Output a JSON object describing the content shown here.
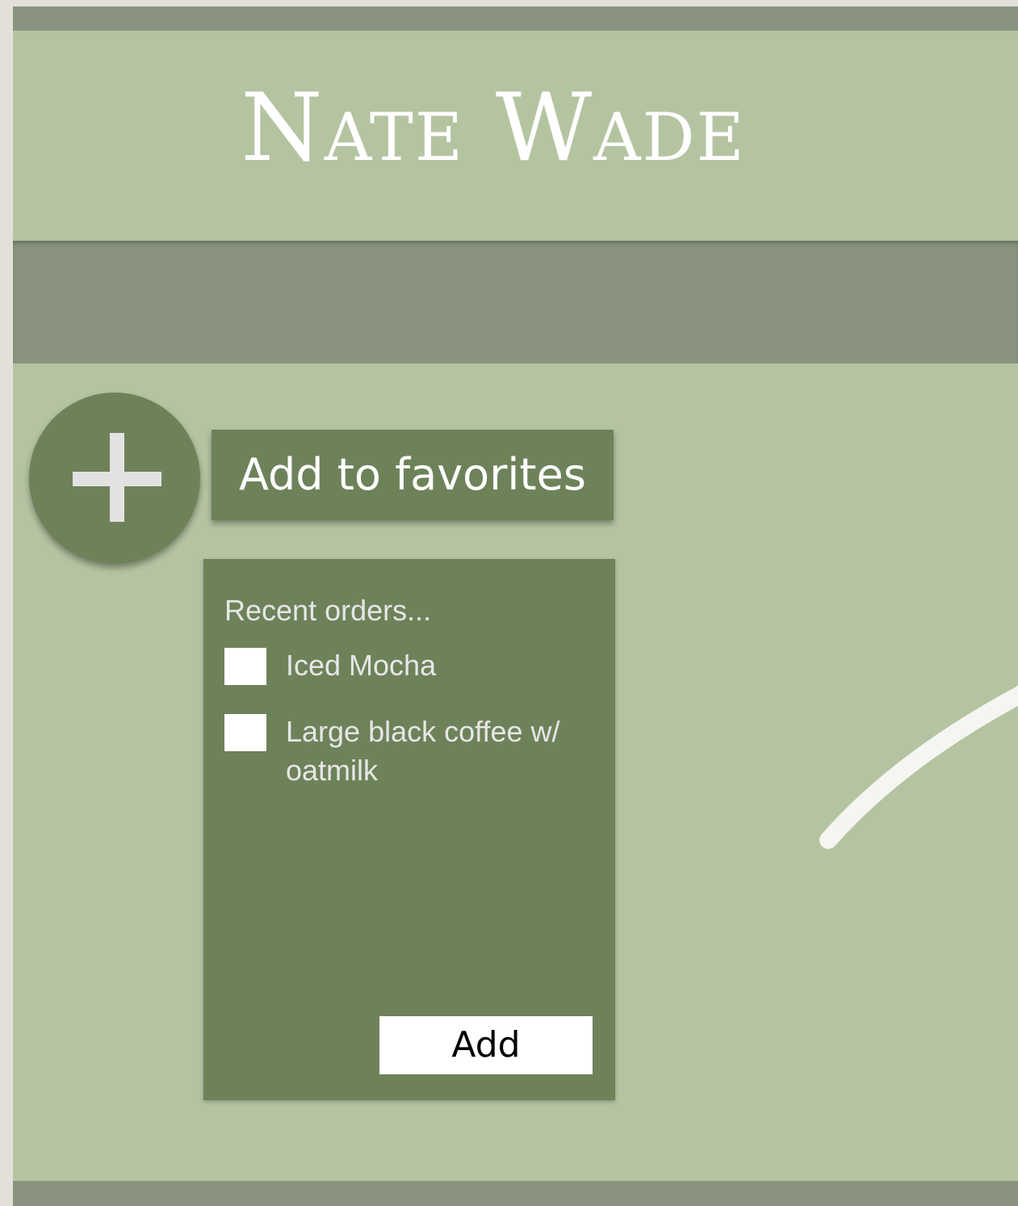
{
  "header": {
    "brand": "Nate Wade"
  },
  "favorites": {
    "plus_icon": "plus-icon",
    "label": "Add to favorites"
  },
  "recent_orders": {
    "title": "Recent orders...",
    "items": [
      {
        "label": "Iced Mocha",
        "checked": false
      },
      {
        "label": "Large black coffee w/ oatmilk",
        "checked": false
      }
    ],
    "add_label": "Add"
  },
  "colors": {
    "page_background": "#b4c4a1",
    "band": "#899380",
    "panel": "#6e825a",
    "text_light": "#ffffff",
    "outer_frame": "#e3e0d9"
  }
}
